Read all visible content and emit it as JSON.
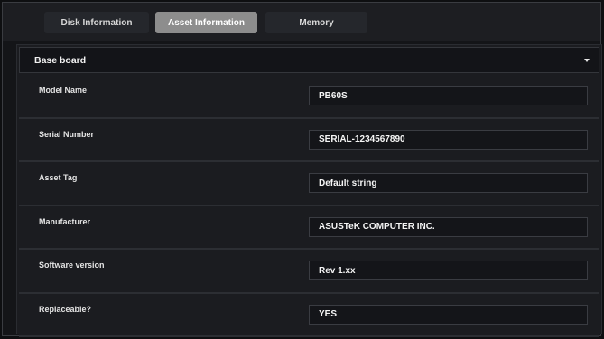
{
  "tabs": [
    {
      "label": "Disk Information",
      "active": false
    },
    {
      "label": "Asset Information",
      "active": true
    },
    {
      "label": "Memory",
      "active": false
    }
  ],
  "section": {
    "title": "Base board",
    "expand_icon": "caret-down-icon"
  },
  "fields": [
    {
      "label": "Model Name",
      "value": "PB60S"
    },
    {
      "label": "Serial Number",
      "value": "SERIAL-1234567890"
    },
    {
      "label": "Asset Tag",
      "value": "Default string"
    },
    {
      "label": "Manufacturer",
      "value": "ASUSTeK COMPUTER INC."
    },
    {
      "label": "Software version",
      "value": "Rev 1.xx"
    },
    {
      "label": "Replaceable?",
      "value": "YES"
    }
  ],
  "colors": {
    "active_tab": "#8d8d8d",
    "background": "#0e0f11"
  }
}
